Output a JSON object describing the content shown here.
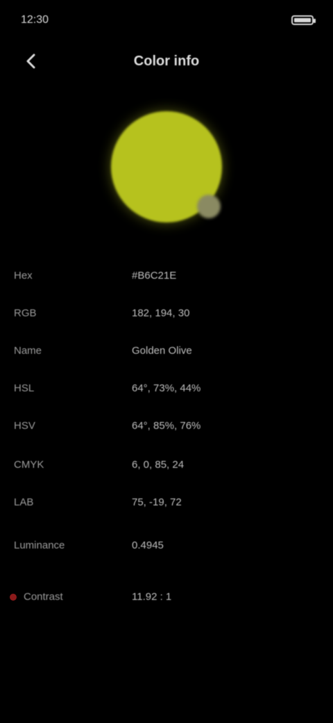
{
  "status_bar": {
    "time": "12:30",
    "battery_percent": 100
  },
  "header": {
    "title": "Color info",
    "back_icon": "arrow-back-icon"
  },
  "swatch": {
    "color": "#b6c21e",
    "edit_icon": "edit-icon"
  },
  "properties": [
    {
      "label": "Hex",
      "value": "#B6C21E"
    },
    {
      "label": "RGB",
      "value": "182, 194, 30"
    },
    {
      "label": "Name",
      "value": "Golden Olive"
    },
    {
      "label": "HSL",
      "value": "64°, 73%, 44%"
    },
    {
      "label": "HSV",
      "value": "64°, 85%, 76%"
    },
    {
      "label": "CMYK",
      "value": "6, 0, 85, 24"
    },
    {
      "label": "LAB",
      "value": "75, -19, 72"
    },
    {
      "label": "Luminance",
      "value": "0.4945"
    },
    {
      "label": "Contrast",
      "value": "11.92 : 1"
    }
  ],
  "colors": {
    "background": "#000000",
    "text_primary": "#dcdcdc",
    "text_secondary": "#9a9a9a",
    "warn": "#8b1a1a"
  }
}
